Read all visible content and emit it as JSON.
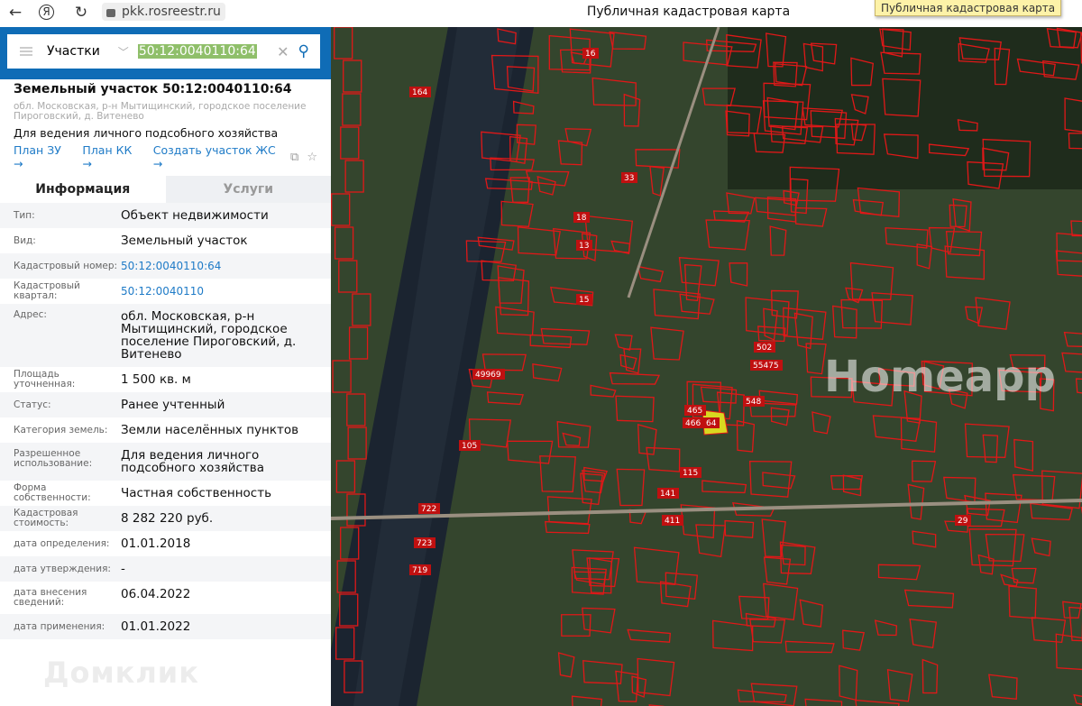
{
  "browser": {
    "url": "pkk.rosreestr.ru",
    "window_title": "Публичная кадастровая карта",
    "tooltip": "Публичная кадастровая карта",
    "back": "←",
    "yandex": "Я",
    "reload": "↻"
  },
  "search": {
    "category": "Участки",
    "query": "50:12:0040110:64"
  },
  "object": {
    "title": "Земельный участок 50:12:0040110:64",
    "address": "обл. Московская, р-н Мытищинский, городское поселение Пироговский, д. Витенево",
    "purpose": "Для ведения личного подсобного хозяйства",
    "links": [
      "План ЗУ →",
      "План КК →",
      "Создать участок ЖС →"
    ]
  },
  "tabs": [
    "Информация",
    "Услуги"
  ],
  "rows": [
    {
      "label": "Тип:",
      "value": "Объект недвижимости"
    },
    {
      "label": "Вид:",
      "value": "Земельный участок"
    },
    {
      "label": "Кадастровый номер:",
      "value": "50:12:0040110:64"
    },
    {
      "label": "Кадастровый квартал:",
      "value": "50:12:0040110"
    },
    {
      "label": "Адрес:",
      "value": "обл. Московская, р-н Мытищинский, городское поселение Пироговский, д. Витенево"
    },
    {
      "label": "Площадь уточненная:",
      "value": "1 500 кв. м"
    },
    {
      "label": "Статус:",
      "value": "Ранее учтенный"
    },
    {
      "label": "Категория земель:",
      "value": "Земли населённых пунктов"
    },
    {
      "label": "Разрешенное использование:",
      "value": "Для ведения личного подсобного хозяйства"
    },
    {
      "label": "Форма собственности:",
      "value": "Частная собственность"
    },
    {
      "label": "Кадастровая стоимость:",
      "value": "8 282 220 руб."
    },
    {
      "label": "дата определения:",
      "value": "01.01.2018"
    },
    {
      "label": "дата утверждения:",
      "value": "-"
    },
    {
      "label": "дата внесения сведений:",
      "value": "06.04.2022"
    },
    {
      "label": "дата применения:",
      "value": "01.01.2022"
    }
  ],
  "watermarks": {
    "panel": "Домклик",
    "map": "Homeapp"
  },
  "map_labels": [
    "164",
    "49969",
    "33",
    "105",
    "115",
    "29",
    "548",
    "502",
    "55475",
    "722",
    "723",
    "719",
    "16",
    "18",
    "13",
    "15",
    "141",
    "411",
    "465",
    "466",
    "64"
  ]
}
